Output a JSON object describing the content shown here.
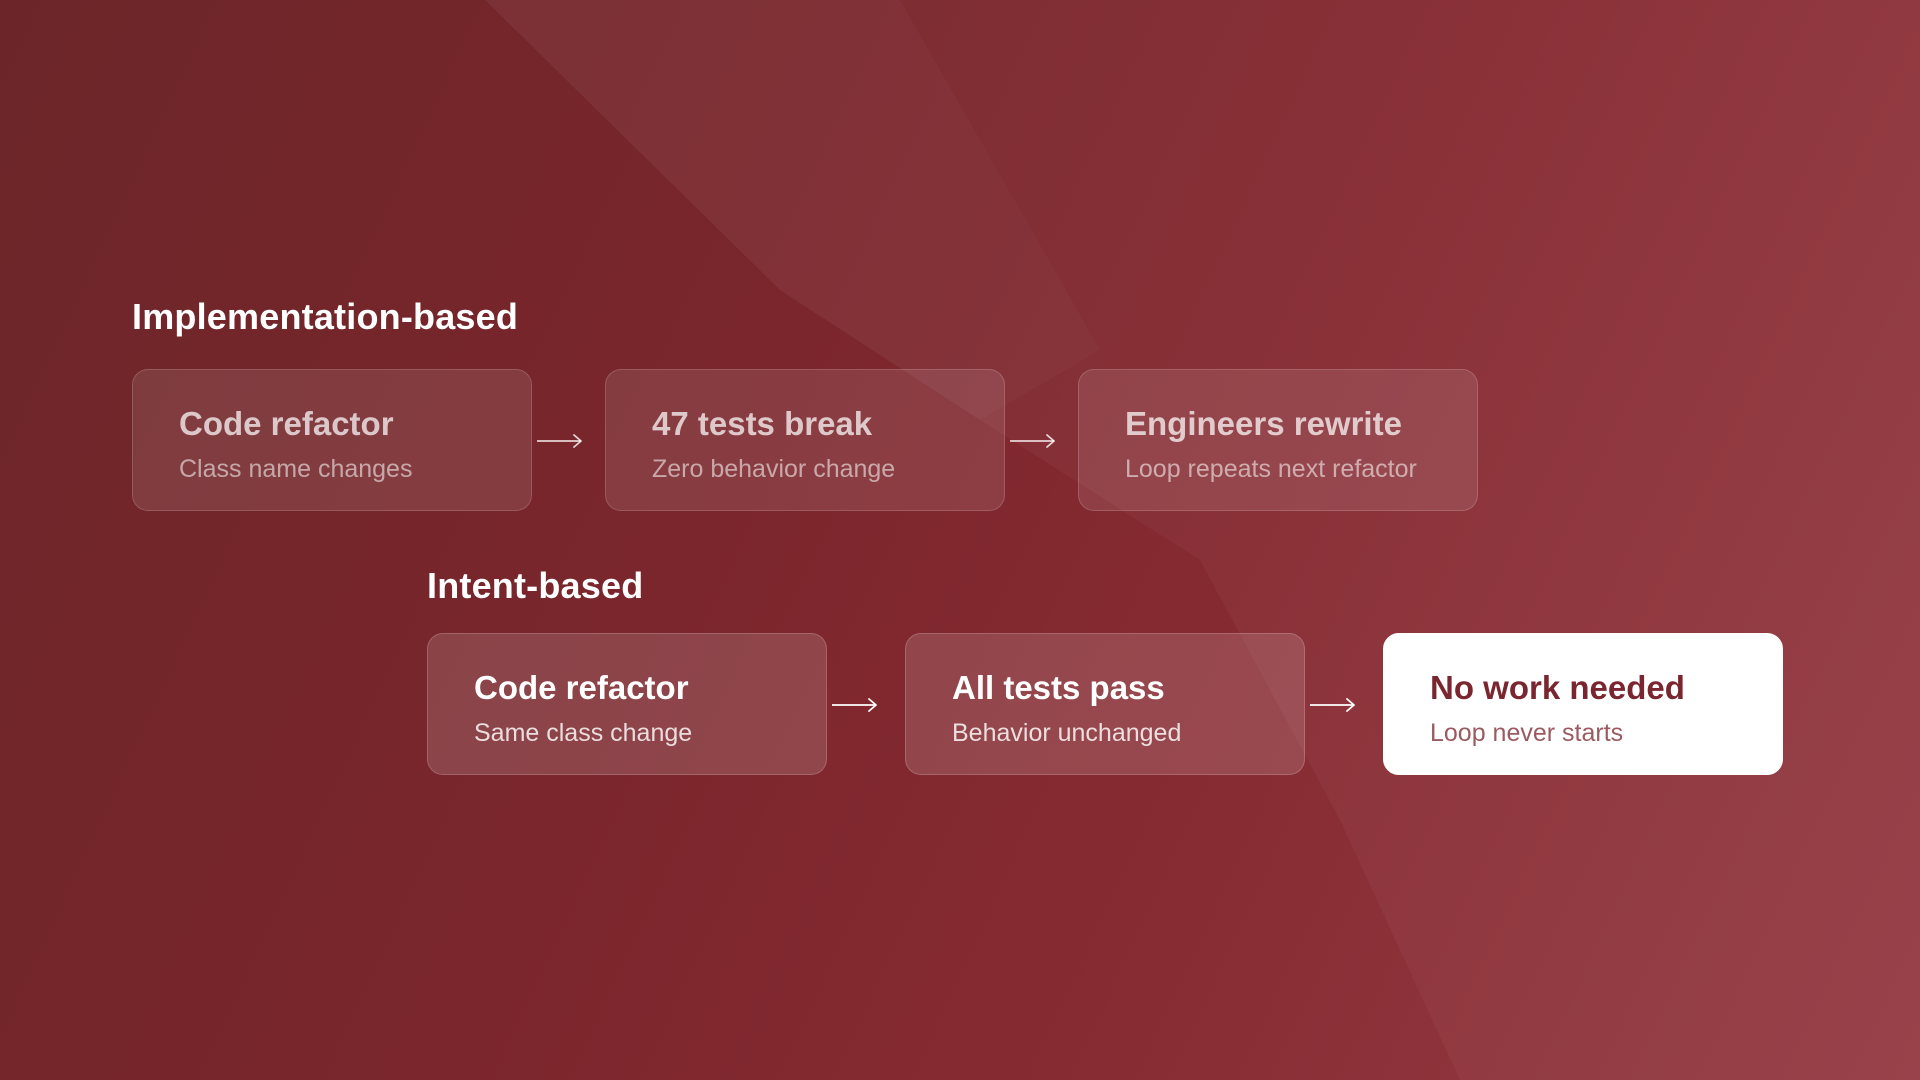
{
  "colors": {
    "background_dark": "#6c2629",
    "background_light": "#963c45",
    "highlight_box": "#ffffff",
    "highlight_text": "#7a2630"
  },
  "rows": [
    {
      "title": "Implementation-based",
      "steps": [
        {
          "title": "Code refactor",
          "subtitle": "Class name changes"
        },
        {
          "title": "47 tests break",
          "subtitle": "Zero behavior change"
        },
        {
          "title": "Engineers rewrite",
          "subtitle": "Loop repeats next refactor"
        }
      ]
    },
    {
      "title": "Intent-based",
      "steps": [
        {
          "title": "Code refactor",
          "subtitle": "Same class change"
        },
        {
          "title": "All tests pass",
          "subtitle": "Behavior unchanged"
        },
        {
          "title": "No work needed",
          "subtitle": "Loop never starts",
          "highlighted": true
        }
      ]
    }
  ],
  "icons": {
    "connector": "arrow-right-icon"
  }
}
